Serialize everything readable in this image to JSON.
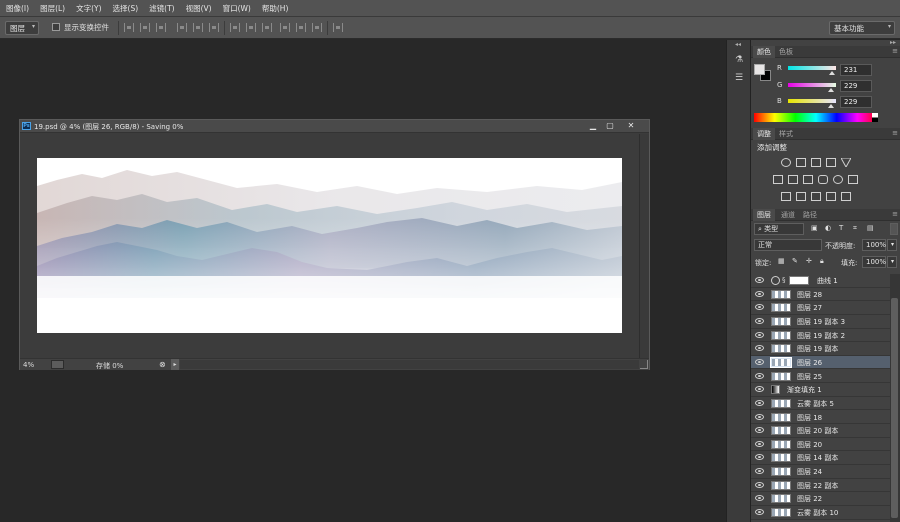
{
  "menubar": {
    "items": [
      "图像(I)",
      "图层(L)",
      "文字(Y)",
      "选择(S)",
      "滤镜(T)",
      "视图(V)",
      "窗口(W)",
      "帮助(H)"
    ]
  },
  "options": {
    "auto_select": "图层",
    "show_transform_label": "显示变换控件",
    "workspace": "基本功能"
  },
  "document": {
    "title": "19.psd @ 4% (图层 26, RGB/8) - Saving 0%",
    "zoom": "4%",
    "save_status": "存储 0%",
    "ps_icon": "Ps"
  },
  "color_panel": {
    "tabs": [
      "颜色",
      "色板"
    ],
    "channels": [
      {
        "label": "R",
        "value": "231"
      },
      {
        "label": "G",
        "value": "229"
      },
      {
        "label": "B",
        "value": "229"
      }
    ],
    "foreground": "#e7e5e5",
    "background": "#000000"
  },
  "adjustments_panel": {
    "tabs": [
      "调整",
      "样式"
    ],
    "heading": "添加调整"
  },
  "layers_panel": {
    "tabs": [
      "图层",
      "通道",
      "路径"
    ],
    "filter_kind": "类型",
    "blend_mode": "正常",
    "opacity_label": "不透明度:",
    "opacity": "100%",
    "lock_label": "锁定:",
    "fill_label": "填充:",
    "fill": "100%",
    "layers": [
      {
        "name": "曲线 1",
        "kind": "adjustment",
        "selected": false
      },
      {
        "name": "图层 28",
        "kind": "pixel",
        "selected": false
      },
      {
        "name": "图层 27",
        "kind": "pixel",
        "selected": false
      },
      {
        "name": "图层 19 副本 3",
        "kind": "pixel",
        "selected": false
      },
      {
        "name": "图层 19 副本 2",
        "kind": "pixel",
        "selected": false
      },
      {
        "name": "图层 19 副本",
        "kind": "pixel",
        "selected": false
      },
      {
        "name": "图层 26",
        "kind": "pixel",
        "selected": true
      },
      {
        "name": "图层 25",
        "kind": "pixel",
        "selected": false
      },
      {
        "name": "渐变填充 1",
        "kind": "gradient",
        "selected": false
      },
      {
        "name": "云雾 副本 5",
        "kind": "pixel",
        "selected": false
      },
      {
        "name": "图层 18",
        "kind": "pixel",
        "selected": false
      },
      {
        "name": "图层 20 副本",
        "kind": "pixel",
        "selected": false
      },
      {
        "name": "图层 20",
        "kind": "pixel",
        "selected": false
      },
      {
        "name": "图层 14 副本",
        "kind": "pixel",
        "selected": false
      },
      {
        "name": "图层 24",
        "kind": "pixel",
        "selected": false
      },
      {
        "name": "图层 22 副本",
        "kind": "pixel",
        "selected": false
      },
      {
        "name": "图层 22",
        "kind": "pixel",
        "selected": false
      },
      {
        "name": "云雾 副本 10",
        "kind": "pixel",
        "selected": false
      }
    ]
  }
}
